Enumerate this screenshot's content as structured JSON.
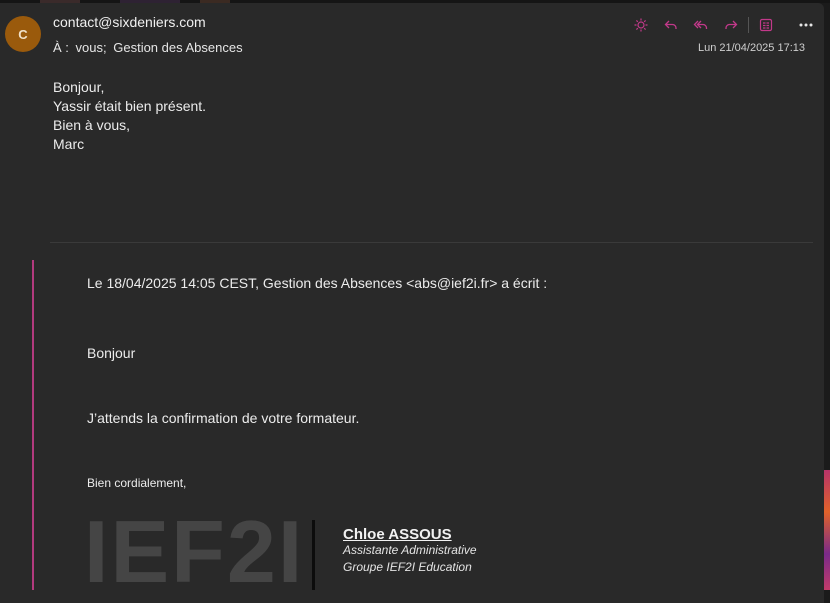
{
  "sender": {
    "avatar_initial": "C",
    "email": "contact@sixdeniers.com"
  },
  "recipients": {
    "prefix": "À :",
    "to": [
      "vous;",
      "Gestion des Absences"
    ]
  },
  "date": "Lun 21/04/2025 17:13",
  "toolbar": {
    "icons": [
      "sun-icon",
      "reply-icon",
      "reply-all-icon",
      "forward-icon",
      "apps-icon",
      "more-icon"
    ],
    "accent": "#c2398a"
  },
  "message": {
    "lines": [
      "Bonjour,",
      "Yassir était bien présent.",
      "Bien à vous,",
      "Marc"
    ]
  },
  "quoted": {
    "header": "Le 18/04/2025 14:05 CEST, Gestion des Absences <abs@ief2i.fr> a écrit :",
    "greeting": "Bonjour",
    "text": "J’attends la confirmation de votre formateur.",
    "closing": "Bien cordialement,"
  },
  "signature": {
    "logo_text": "IEF2I",
    "name": "Chloe ASSOUS",
    "role": "Assistante Administrative",
    "org": "Groupe IEF2I Education"
  }
}
